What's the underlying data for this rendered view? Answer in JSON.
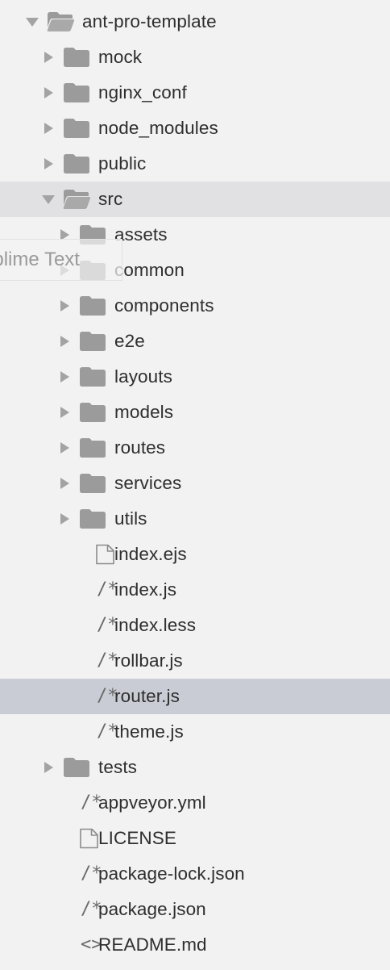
{
  "sidebar": {
    "tree": [
      {
        "depth": 0,
        "kind": "folder",
        "expanded": true,
        "label": "ant-pro-template",
        "icon": "folder-open-icon"
      },
      {
        "depth": 1,
        "kind": "folder",
        "expanded": false,
        "label": "mock",
        "icon": "folder-icon"
      },
      {
        "depth": 1,
        "kind": "folder",
        "expanded": false,
        "label": "nginx_conf",
        "icon": "folder-icon"
      },
      {
        "depth": 1,
        "kind": "folder",
        "expanded": false,
        "label": "node_modules",
        "icon": "folder-icon"
      },
      {
        "depth": 1,
        "kind": "folder",
        "expanded": false,
        "label": "public",
        "icon": "folder-icon"
      },
      {
        "depth": 1,
        "kind": "folder",
        "expanded": true,
        "label": "src",
        "icon": "folder-open-icon",
        "highlight": "folder"
      },
      {
        "depth": 2,
        "kind": "folder",
        "expanded": false,
        "label": "assets",
        "icon": "folder-icon"
      },
      {
        "depth": 2,
        "kind": "folder",
        "expanded": false,
        "label": "common",
        "icon": "folder-icon"
      },
      {
        "depth": 2,
        "kind": "folder",
        "expanded": false,
        "label": "components",
        "icon": "folder-icon"
      },
      {
        "depth": 2,
        "kind": "folder",
        "expanded": false,
        "label": "e2e",
        "icon": "folder-icon"
      },
      {
        "depth": 2,
        "kind": "folder",
        "expanded": false,
        "label": "layouts",
        "icon": "folder-icon"
      },
      {
        "depth": 2,
        "kind": "folder",
        "expanded": false,
        "label": "models",
        "icon": "folder-icon"
      },
      {
        "depth": 2,
        "kind": "folder",
        "expanded": false,
        "label": "routes",
        "icon": "folder-icon"
      },
      {
        "depth": 2,
        "kind": "folder",
        "expanded": false,
        "label": "services",
        "icon": "folder-icon"
      },
      {
        "depth": 2,
        "kind": "folder",
        "expanded": false,
        "label": "utils",
        "icon": "folder-icon"
      },
      {
        "depth": 2,
        "kind": "file",
        "label": "index.ejs",
        "icon": "document-icon"
      },
      {
        "depth": 2,
        "kind": "file",
        "label": "index.js",
        "icon": "code-comment-icon",
        "glyph": "/*"
      },
      {
        "depth": 2,
        "kind": "file",
        "label": "index.less",
        "icon": "code-comment-icon",
        "glyph": "/*"
      },
      {
        "depth": 2,
        "kind": "file",
        "label": "rollbar.js",
        "icon": "code-comment-icon",
        "glyph": "/*"
      },
      {
        "depth": 2,
        "kind": "file",
        "label": "router.js",
        "icon": "code-comment-icon",
        "glyph": "/*",
        "highlight": "file"
      },
      {
        "depth": 2,
        "kind": "file",
        "label": "theme.js",
        "icon": "code-comment-icon",
        "glyph": "/*"
      },
      {
        "depth": 1,
        "kind": "folder",
        "expanded": false,
        "label": "tests",
        "icon": "folder-icon"
      },
      {
        "depth": 1,
        "kind": "file",
        "label": "appveyor.yml",
        "icon": "code-comment-icon",
        "glyph": "/*"
      },
      {
        "depth": 1,
        "kind": "file",
        "label": "LICENSE",
        "icon": "document-icon"
      },
      {
        "depth": 1,
        "kind": "file",
        "label": "package-lock.json",
        "icon": "code-comment-icon",
        "glyph": "/*"
      },
      {
        "depth": 1,
        "kind": "file",
        "label": "package.json",
        "icon": "code-comment-icon",
        "glyph": "/*"
      },
      {
        "depth": 1,
        "kind": "file",
        "label": "README.md",
        "icon": "markup-icon",
        "glyph": "<>"
      }
    ]
  },
  "tooltip": {
    "text": "Sublime Text"
  },
  "colors": {
    "background": "#f2f2f2",
    "folder_highlight": "#e1e1e3",
    "file_highlight": "#c9ccd4",
    "icon": "#9b9b9b",
    "text": "#2e2e2e"
  }
}
